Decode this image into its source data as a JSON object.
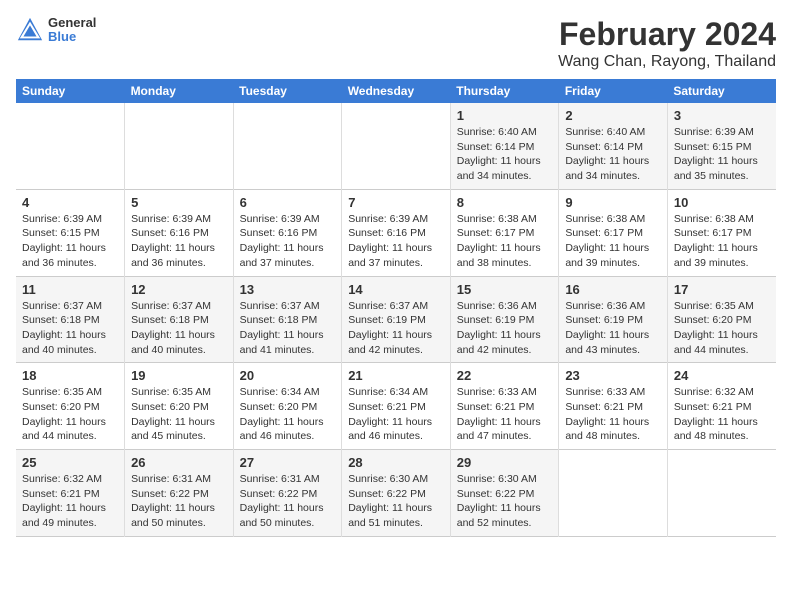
{
  "header": {
    "logo": {
      "general": "General",
      "blue": "Blue"
    },
    "title": "February 2024",
    "subtitle": "Wang Chan, Rayong, Thailand"
  },
  "days_of_week": [
    "Sunday",
    "Monday",
    "Tuesday",
    "Wednesday",
    "Thursday",
    "Friday",
    "Saturday"
  ],
  "weeks": [
    [
      {
        "day": "",
        "info": ""
      },
      {
        "day": "",
        "info": ""
      },
      {
        "day": "",
        "info": ""
      },
      {
        "day": "",
        "info": ""
      },
      {
        "day": "1",
        "info": "Sunrise: 6:40 AM\nSunset: 6:14 PM\nDaylight: 11 hours and 34 minutes."
      },
      {
        "day": "2",
        "info": "Sunrise: 6:40 AM\nSunset: 6:14 PM\nDaylight: 11 hours and 34 minutes."
      },
      {
        "day": "3",
        "info": "Sunrise: 6:39 AM\nSunset: 6:15 PM\nDaylight: 11 hours and 35 minutes."
      }
    ],
    [
      {
        "day": "4",
        "info": "Sunrise: 6:39 AM\nSunset: 6:15 PM\nDaylight: 11 hours and 36 minutes."
      },
      {
        "day": "5",
        "info": "Sunrise: 6:39 AM\nSunset: 6:16 PM\nDaylight: 11 hours and 36 minutes."
      },
      {
        "day": "6",
        "info": "Sunrise: 6:39 AM\nSunset: 6:16 PM\nDaylight: 11 hours and 37 minutes."
      },
      {
        "day": "7",
        "info": "Sunrise: 6:39 AM\nSunset: 6:16 PM\nDaylight: 11 hours and 37 minutes."
      },
      {
        "day": "8",
        "info": "Sunrise: 6:38 AM\nSunset: 6:17 PM\nDaylight: 11 hours and 38 minutes."
      },
      {
        "day": "9",
        "info": "Sunrise: 6:38 AM\nSunset: 6:17 PM\nDaylight: 11 hours and 39 minutes."
      },
      {
        "day": "10",
        "info": "Sunrise: 6:38 AM\nSunset: 6:17 PM\nDaylight: 11 hours and 39 minutes."
      }
    ],
    [
      {
        "day": "11",
        "info": "Sunrise: 6:37 AM\nSunset: 6:18 PM\nDaylight: 11 hours and 40 minutes."
      },
      {
        "day": "12",
        "info": "Sunrise: 6:37 AM\nSunset: 6:18 PM\nDaylight: 11 hours and 40 minutes."
      },
      {
        "day": "13",
        "info": "Sunrise: 6:37 AM\nSunset: 6:18 PM\nDaylight: 11 hours and 41 minutes."
      },
      {
        "day": "14",
        "info": "Sunrise: 6:37 AM\nSunset: 6:19 PM\nDaylight: 11 hours and 42 minutes."
      },
      {
        "day": "15",
        "info": "Sunrise: 6:36 AM\nSunset: 6:19 PM\nDaylight: 11 hours and 42 minutes."
      },
      {
        "day": "16",
        "info": "Sunrise: 6:36 AM\nSunset: 6:19 PM\nDaylight: 11 hours and 43 minutes."
      },
      {
        "day": "17",
        "info": "Sunrise: 6:35 AM\nSunset: 6:20 PM\nDaylight: 11 hours and 44 minutes."
      }
    ],
    [
      {
        "day": "18",
        "info": "Sunrise: 6:35 AM\nSunset: 6:20 PM\nDaylight: 11 hours and 44 minutes."
      },
      {
        "day": "19",
        "info": "Sunrise: 6:35 AM\nSunset: 6:20 PM\nDaylight: 11 hours and 45 minutes."
      },
      {
        "day": "20",
        "info": "Sunrise: 6:34 AM\nSunset: 6:20 PM\nDaylight: 11 hours and 46 minutes."
      },
      {
        "day": "21",
        "info": "Sunrise: 6:34 AM\nSunset: 6:21 PM\nDaylight: 11 hours and 46 minutes."
      },
      {
        "day": "22",
        "info": "Sunrise: 6:33 AM\nSunset: 6:21 PM\nDaylight: 11 hours and 47 minutes."
      },
      {
        "day": "23",
        "info": "Sunrise: 6:33 AM\nSunset: 6:21 PM\nDaylight: 11 hours and 48 minutes."
      },
      {
        "day": "24",
        "info": "Sunrise: 6:32 AM\nSunset: 6:21 PM\nDaylight: 11 hours and 48 minutes."
      }
    ],
    [
      {
        "day": "25",
        "info": "Sunrise: 6:32 AM\nSunset: 6:21 PM\nDaylight: 11 hours and 49 minutes."
      },
      {
        "day": "26",
        "info": "Sunrise: 6:31 AM\nSunset: 6:22 PM\nDaylight: 11 hours and 50 minutes."
      },
      {
        "day": "27",
        "info": "Sunrise: 6:31 AM\nSunset: 6:22 PM\nDaylight: 11 hours and 50 minutes."
      },
      {
        "day": "28",
        "info": "Sunrise: 6:30 AM\nSunset: 6:22 PM\nDaylight: 11 hours and 51 minutes."
      },
      {
        "day": "29",
        "info": "Sunrise: 6:30 AM\nSunset: 6:22 PM\nDaylight: 11 hours and 52 minutes."
      },
      {
        "day": "",
        "info": ""
      },
      {
        "day": "",
        "info": ""
      }
    ]
  ]
}
